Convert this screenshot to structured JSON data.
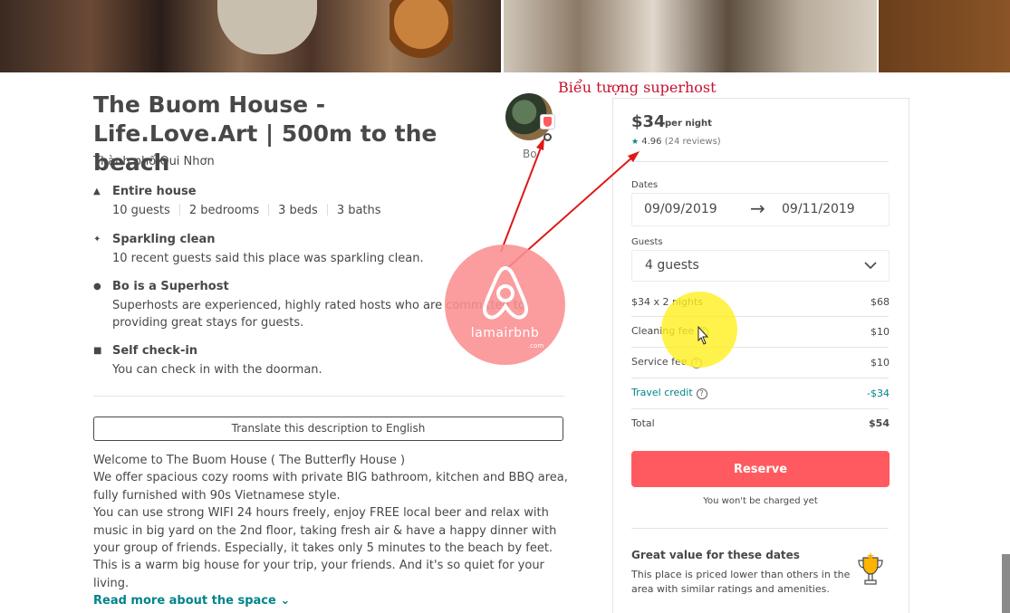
{
  "listing": {
    "title": "The Buom House - Life.Love.Art | 500m to the beach",
    "location": "Thành phố Qui Nhơn",
    "host_name": "Bo"
  },
  "features": [
    {
      "icon": "house-icon",
      "title": "Entire house",
      "facts": [
        "10 guests",
        "2 bedrooms",
        "3 beds",
        "3 baths"
      ]
    },
    {
      "icon": "sparkle-icon",
      "title": "Sparkling clean",
      "desc_lines": [
        "10 recent guests said this place was sparkling clean."
      ]
    },
    {
      "icon": "medal-icon",
      "title": "Bo is a Superhost",
      "desc_lines": [
        "Superhosts are experienced, highly rated hosts who are committed to",
        "providing great stays for guests."
      ]
    },
    {
      "icon": "door-icon",
      "title": "Self check-in",
      "desc_lines": [
        "You can check in with the doorman."
      ]
    }
  ],
  "translate_label": "Translate this description to English",
  "description_lines": [
    "Welcome to The Buom House ( The Butterfly House )",
    "We offer spacious cozy rooms with private BIG bathroom, kitchen and BBQ area,",
    "fully furnished with 90s Vietnamese style.",
    "You can use strong WIFI 24 hours freely, enjoy FREE local beer and relax with",
    "music in big yard on the 2nd floor, taking fresh air & have a happy dinner with",
    "your group of friends. Especially, it takes only 5 minutes to the beach by feet.",
    "This is a warm big house for your trip, your friends. And it's so quiet for your living."
  ],
  "read_more_label": "Read more about the space",
  "annotation": {
    "label": "Biểu tượng superhost",
    "watermark": "lamairbnb",
    "watermark_sub": ".com"
  },
  "booking": {
    "price": "$34",
    "per_night": "per night",
    "rating_star": "★",
    "rating": "4.96",
    "reviews": "(24 reviews)",
    "dates_label": "Dates",
    "check_in": "09/09/2019",
    "date_arrow": "→",
    "check_out": "09/11/2019",
    "guests_label": "Guests",
    "guests_value": "4 guests",
    "rows": [
      {
        "label": "$34 x 2 nights",
        "value": "$68"
      },
      {
        "label": "Cleaning fee",
        "value": "$10"
      },
      {
        "label": "Service fee",
        "value": "$10"
      },
      {
        "label": "Travel credit",
        "value": "-$34"
      },
      {
        "label": "Total",
        "value": "$54"
      }
    ],
    "qmark": "?",
    "reserve_label": "Reserve",
    "no_charge": "You won't be charged yet",
    "great_value_title": "Great value for these dates",
    "great_value_desc": "This place is priced lower than others in the area with similar ratings and amenities."
  },
  "colors": {
    "brand": "#ff5a5f",
    "teal": "#008489",
    "annotation": "#c8102e",
    "highlight": "#fff01e"
  }
}
